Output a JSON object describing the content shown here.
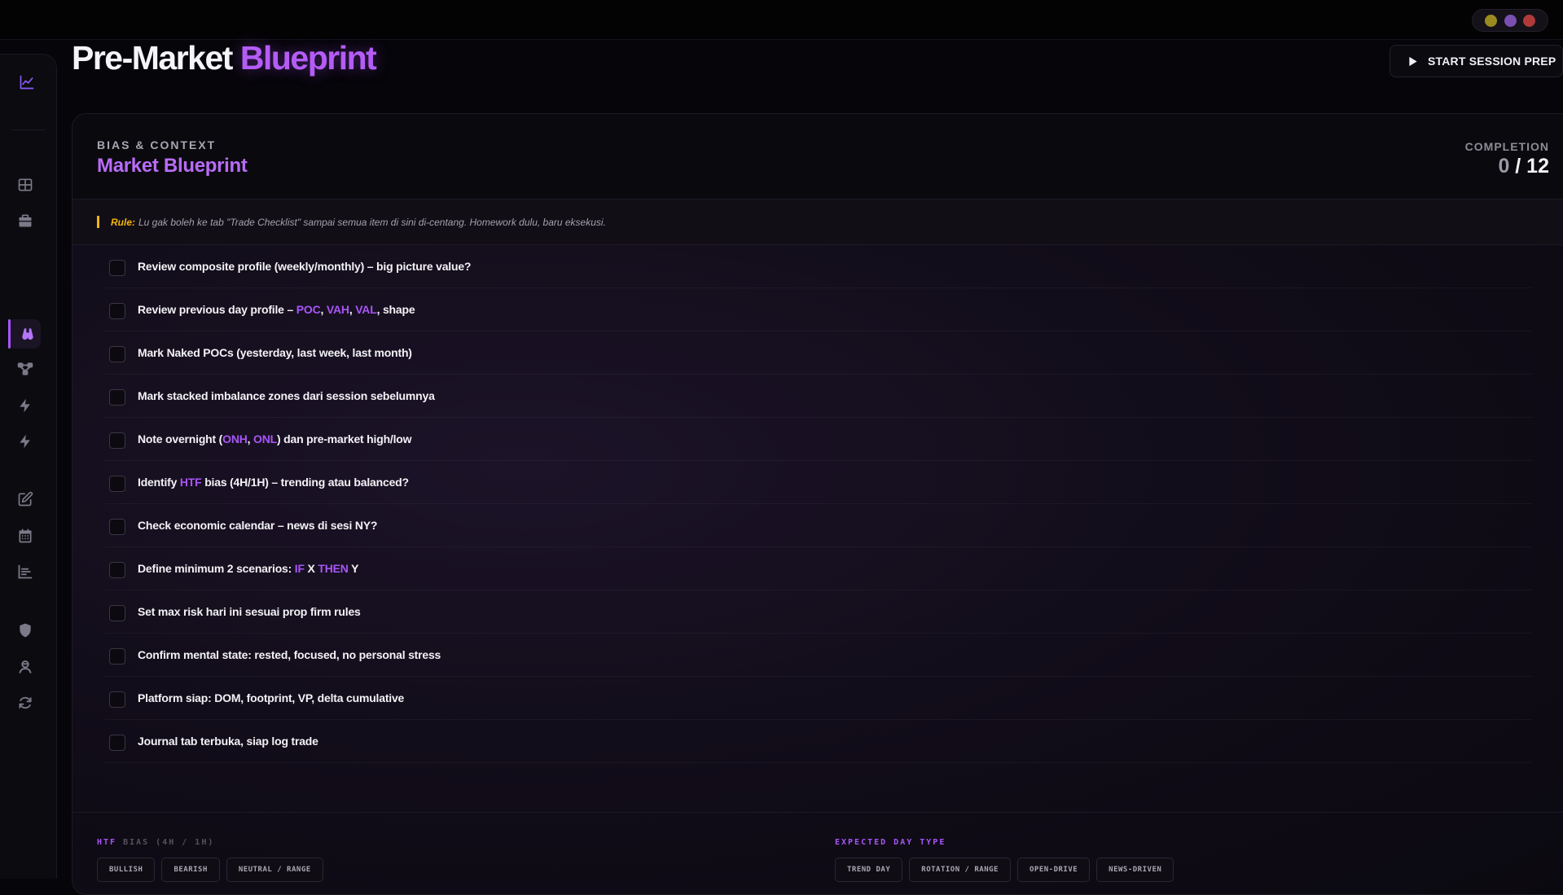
{
  "window": {
    "dot_colors": [
      "#9a8a20",
      "#7a4fb0",
      "#b03a3a"
    ]
  },
  "header": {
    "title_main": "Pre-Market",
    "title_accent": "Blueprint",
    "start_button": "START SESSION PREP"
  },
  "sidebar": {
    "icons": [
      "chart-line-icon",
      "grid-icon",
      "briefcase-icon",
      "binoculars-icon",
      "flow-icon",
      "bolt-icon",
      "bolt-icon",
      "edit-icon",
      "calendar-icon",
      "bar-list-icon",
      "shield-icon",
      "user-icon",
      "refresh-icon"
    ],
    "active": "binoculars-icon"
  },
  "panel": {
    "kicker": "BIAS & CONTEXT",
    "title": "Market Blueprint",
    "completion_label": "COMPLETION",
    "completion_done": "0",
    "completion_total": " / 12",
    "rule_label": "Rule:",
    "rule_text": "Lu gak boleh ke tab \"Trade Checklist\" sampai semua item di sini di-centang. Homework dulu, baru eksekusi."
  },
  "checklist": [
    [
      {
        "t": "Review composite profile (weekly/monthly) – big picture value?"
      }
    ],
    [
      {
        "t": "Review previous day profile – "
      },
      {
        "t": "POC",
        "h": true
      },
      {
        "t": ", "
      },
      {
        "t": "VAH",
        "h": true
      },
      {
        "t": ", "
      },
      {
        "t": "VAL",
        "h": true
      },
      {
        "t": ", shape"
      }
    ],
    [
      {
        "t": "Mark Naked POCs (yesterday, last week, last month)"
      }
    ],
    [
      {
        "t": "Mark stacked imbalance zones dari session sebelumnya"
      }
    ],
    [
      {
        "t": "Note overnight ("
      },
      {
        "t": "ONH",
        "h": true
      },
      {
        "t": ", "
      },
      {
        "t": "ONL",
        "h": true
      },
      {
        "t": ") dan pre-market high/low"
      }
    ],
    [
      {
        "t": "Identify "
      },
      {
        "t": "HTF",
        "h": true
      },
      {
        "t": " bias (4H/1H) – trending atau balanced?"
      }
    ],
    [
      {
        "t": "Check economic calendar – news di sesi NY?"
      }
    ],
    [
      {
        "t": "Define minimum 2 scenarios: "
      },
      {
        "t": "IF",
        "h": true
      },
      {
        "t": " X "
      },
      {
        "t": "THEN",
        "h": true
      },
      {
        "t": " Y"
      }
    ],
    [
      {
        "t": "Set max risk hari ini sesuai prop firm rules"
      }
    ],
    [
      {
        "t": "Confirm mental state: rested, focused, no personal stress"
      }
    ],
    [
      {
        "t": "Platform siap: DOM, footprint, VP, delta cumulative"
      }
    ],
    [
      {
        "t": "Journal tab terbuka, siap log trade"
      }
    ]
  ],
  "htf_bias": {
    "label_accent": "HTF",
    "label_rest": " BIAS (4H / 1H)",
    "options": [
      "BULLISH",
      "BEARISH",
      "NEUTRAL / RANGE"
    ]
  },
  "day_type": {
    "label": "EXPECTED DAY TYPE",
    "options": [
      "TREND DAY",
      "ROTATION / RANGE",
      "OPEN-DRIVE",
      "NEWS-DRIVEN"
    ]
  }
}
